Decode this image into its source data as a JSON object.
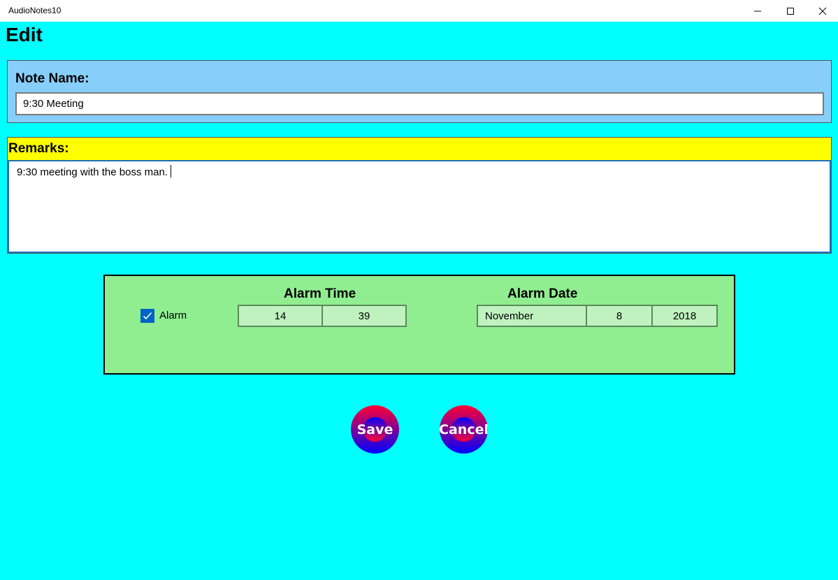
{
  "window": {
    "title": "AudioNotes10"
  },
  "page": {
    "title": "Edit"
  },
  "note": {
    "name_label": "Note Name:",
    "name_value": "9:30 Meeting",
    "remarks_label": "Remarks:",
    "remarks_value": "9:30 meeting with the boss man."
  },
  "alarm": {
    "checkbox_label": "Alarm",
    "checked": true,
    "time_label": "Alarm Time",
    "hour": "14",
    "minute": "39",
    "date_label": "Alarm Date",
    "month": "November",
    "day": "8",
    "year": "2018"
  },
  "buttons": {
    "save_label": "Save",
    "cancel_label": "Cancel"
  },
  "colors": {
    "background": "#00ffff",
    "name_panel": "#87cefa",
    "remarks_panel": "#ffff00",
    "alarm_panel": "#90ee90",
    "button_gradient_top": "#ff0033",
    "button_gradient_bottom": "#0000ff"
  },
  "icons": {
    "minimize": "minimize-icon",
    "maximize": "maximize-icon",
    "close": "close-icon",
    "checkmark": "checkmark-icon"
  }
}
